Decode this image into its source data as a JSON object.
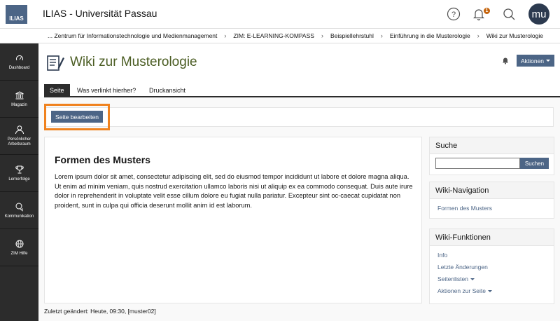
{
  "header": {
    "logo_text": "ILIAS",
    "title": "ILIAS - Universität Passau",
    "notification_count": "1",
    "avatar_initials": "mu"
  },
  "breadcrumb": [
    "... Zentrum für Informationstechnologie und Medienmanagement",
    "ZIM: E-LEARNING-KOMPASS",
    "Beispiellehrstuhl",
    "Einführung in die Musterologie",
    "Wiki zur Musterologie"
  ],
  "sidebar": {
    "items": [
      {
        "label": "Dashboard",
        "icon": "dashboard-icon"
      },
      {
        "label": "Magazin",
        "icon": "library-icon"
      },
      {
        "label": "Persönlicher Arbeitsraum",
        "icon": "user-icon"
      },
      {
        "label": "Lernerfolge",
        "icon": "trophy-icon"
      },
      {
        "label": "Kommunikation",
        "icon": "chat-icon"
      },
      {
        "label": "ZIM Hilfe",
        "icon": "help-globe-icon"
      }
    ]
  },
  "page": {
    "title": "Wiki zur Musterologie",
    "actions_label": "Aktionen"
  },
  "tabs": [
    {
      "label": "Seite",
      "active": true
    },
    {
      "label": "Was verlinkt hierher?",
      "active": false
    },
    {
      "label": "Druckansicht",
      "active": false
    }
  ],
  "toolbar": {
    "edit_label": "Seite bearbeiten"
  },
  "content": {
    "heading": "Formen des Musters",
    "body": "Lorem ipsum dolor sit amet, consectetur adipiscing elit, sed do eiusmod tempor incididunt ut labore et dolore magna aliqua. Ut enim ad minim veniam, quis nostrud exercitation ullamco laboris nisi ut aliquip ex ea commodo consequat. Duis aute irure dolor in reprehenderit in voluptate velit esse cillum dolore eu fugiat nulla pariatur. Excepteur sint oc-caecat cupidatat non proident, sunt in culpa qui officia deserunt mollit anim id est laborum.",
    "last_changed": "Zuletzt geändert: Heute, 09:30, [muster02]"
  },
  "search_panel": {
    "title": "Suche",
    "placeholder": "",
    "button": "Suchen"
  },
  "nav_panel": {
    "title": "Wiki-Navigation",
    "links": [
      "Formen des Musters"
    ]
  },
  "functions_panel": {
    "title": "Wiki-Funktionen",
    "links": [
      "Info",
      "Letzte Änderungen",
      "Seitenlisten",
      "Aktionen zur Seite"
    ]
  },
  "colors": {
    "accent": "#4c6586",
    "highlight": "#f0821e",
    "title_green": "#4b5d23",
    "sidebar": "#2c2c2c"
  }
}
